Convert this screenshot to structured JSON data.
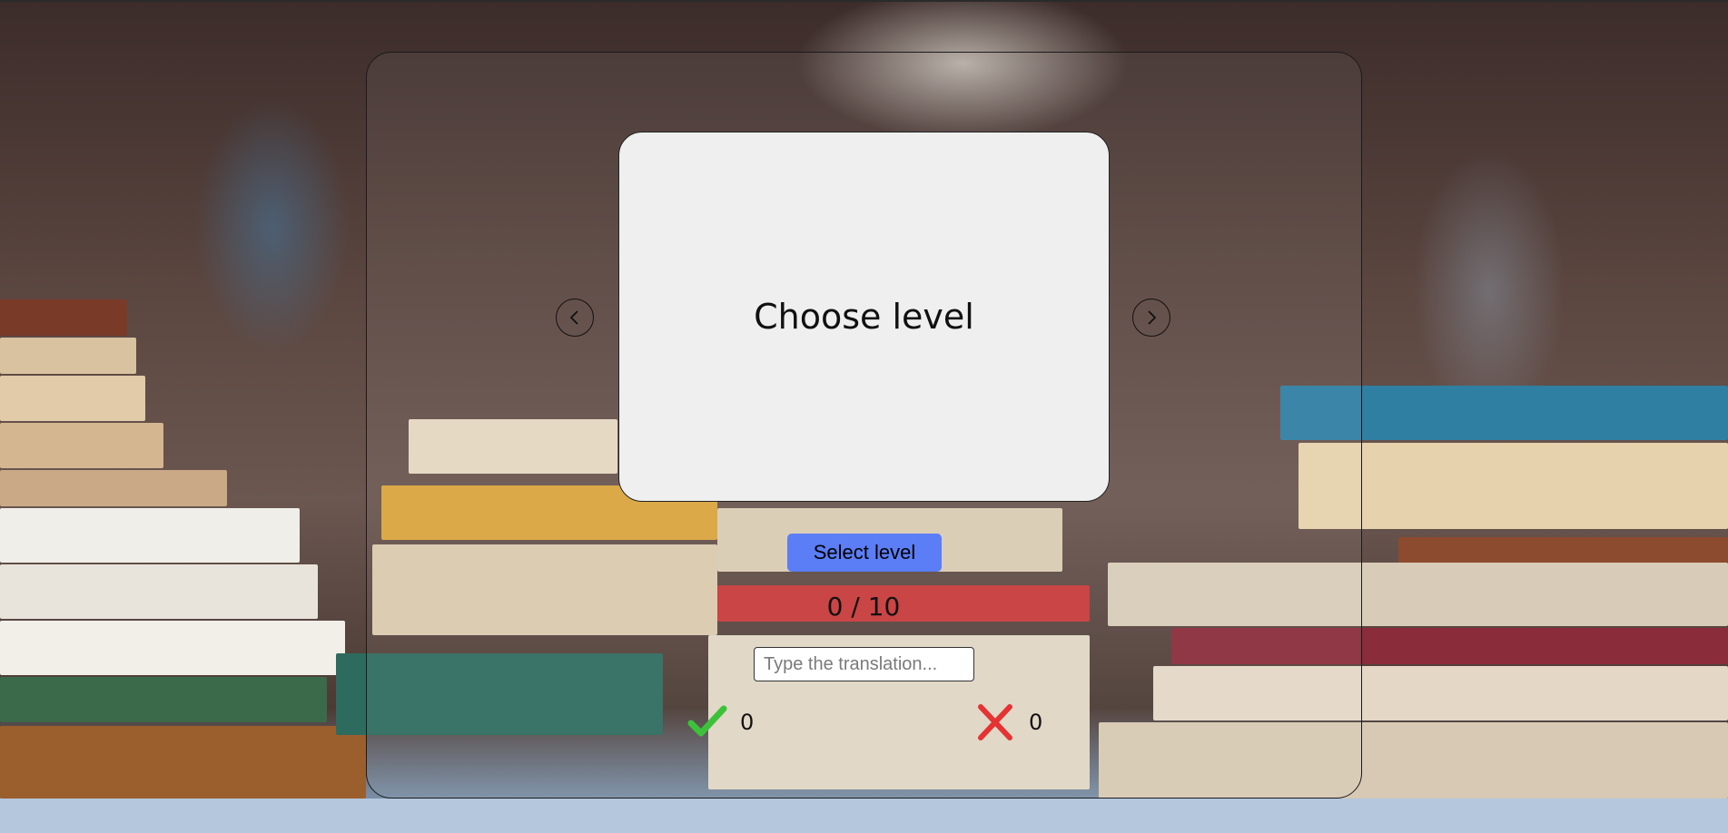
{
  "card": {
    "text": "Choose level"
  },
  "navigation": {
    "prev_icon": "chevron-left-icon",
    "next_icon": "chevron-right-icon"
  },
  "controls": {
    "select_level_label": "Select level",
    "progress_text": "0 / 10",
    "translation_placeholder": "Type the translation..."
  },
  "scores": {
    "correct": "0",
    "wrong": "0"
  },
  "colors": {
    "button": "#5b7df5",
    "correct": "#3cc13b",
    "wrong": "#e53232"
  }
}
